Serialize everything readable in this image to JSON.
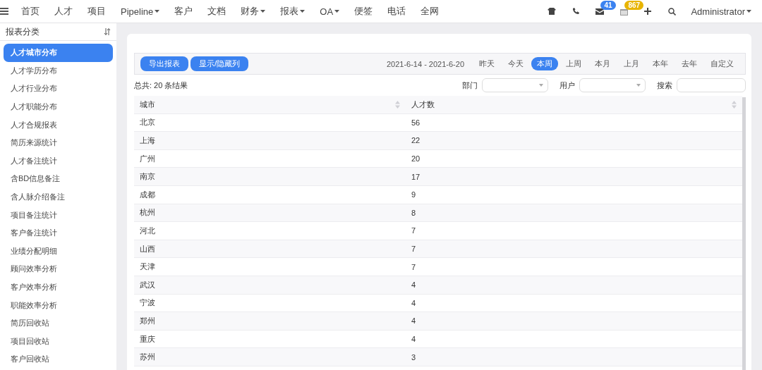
{
  "nav": {
    "items": [
      {
        "label": "首页",
        "dropdown": false
      },
      {
        "label": "人才",
        "dropdown": false
      },
      {
        "label": "项目",
        "dropdown": false
      },
      {
        "label": "Pipeline",
        "dropdown": true
      },
      {
        "label": "客户",
        "dropdown": false
      },
      {
        "label": "文档",
        "dropdown": false
      },
      {
        "label": "财务",
        "dropdown": true
      },
      {
        "label": "报表",
        "dropdown": true
      },
      {
        "label": "OA",
        "dropdown": true
      },
      {
        "label": "便签",
        "dropdown": false
      },
      {
        "label": "电话",
        "dropdown": false
      },
      {
        "label": "全网",
        "dropdown": false
      }
    ],
    "mail_badge": "41",
    "calendar_badge": "867",
    "user": "Administrator"
  },
  "sidebar": {
    "title": "报表分类",
    "items": [
      {
        "label": "人才城市分布",
        "selected": true
      },
      {
        "label": "人才学历分布",
        "selected": false
      },
      {
        "label": "人才行业分布",
        "selected": false
      },
      {
        "label": "人才职能分布",
        "selected": false
      },
      {
        "label": "人才合规报表",
        "selected": false
      },
      {
        "label": "简历来源统计",
        "selected": false
      },
      {
        "label": "人才备注统计",
        "selected": false
      },
      {
        "label": "含BD信息备注",
        "selected": false
      },
      {
        "label": "含人脉介绍备注",
        "selected": false
      },
      {
        "label": "项目备注统计",
        "selected": false
      },
      {
        "label": "客户备注统计",
        "selected": false
      },
      {
        "label": "业绩分配明细",
        "selected": false
      },
      {
        "label": "顾问效率分析",
        "selected": false
      },
      {
        "label": "客户效率分析",
        "selected": false
      },
      {
        "label": "职能效率分析",
        "selected": false
      },
      {
        "label": "简历回收站",
        "selected": false
      },
      {
        "label": "项目回收站",
        "selected": false
      },
      {
        "label": "客户回收站",
        "selected": false
      }
    ]
  },
  "toolbar": {
    "buttons": [
      "导出报表",
      "显示/隐藏列"
    ],
    "date_range": "2021-6-14 - 2021-6-20",
    "periods": [
      {
        "label": "昨天",
        "selected": false
      },
      {
        "label": "今天",
        "selected": false
      },
      {
        "label": "本周",
        "selected": true
      },
      {
        "label": "上周",
        "selected": false
      },
      {
        "label": "本月",
        "selected": false
      },
      {
        "label": "上月",
        "selected": false
      },
      {
        "label": "本年",
        "selected": false
      },
      {
        "label": "去年",
        "selected": false
      },
      {
        "label": "自定义",
        "selected": false
      }
    ]
  },
  "summary": "总共: 20 条结果",
  "filters": {
    "department_label": "部门",
    "user_label": "用户",
    "search_label": "搜索"
  },
  "table": {
    "columns": [
      "城市",
      "人才数"
    ],
    "rows": [
      [
        "北京",
        "56"
      ],
      [
        "上海",
        "22"
      ],
      [
        "广州",
        "20"
      ],
      [
        "南京",
        "17"
      ],
      [
        "成都",
        "9"
      ],
      [
        "杭州",
        "8"
      ],
      [
        "河北",
        "7"
      ],
      [
        "山西",
        "7"
      ],
      [
        "天津",
        "7"
      ],
      [
        "武汉",
        "4"
      ],
      [
        "宁波",
        "4"
      ],
      [
        "郑州",
        "4"
      ],
      [
        "重庆",
        "4"
      ],
      [
        "苏州",
        "3"
      ]
    ]
  }
}
